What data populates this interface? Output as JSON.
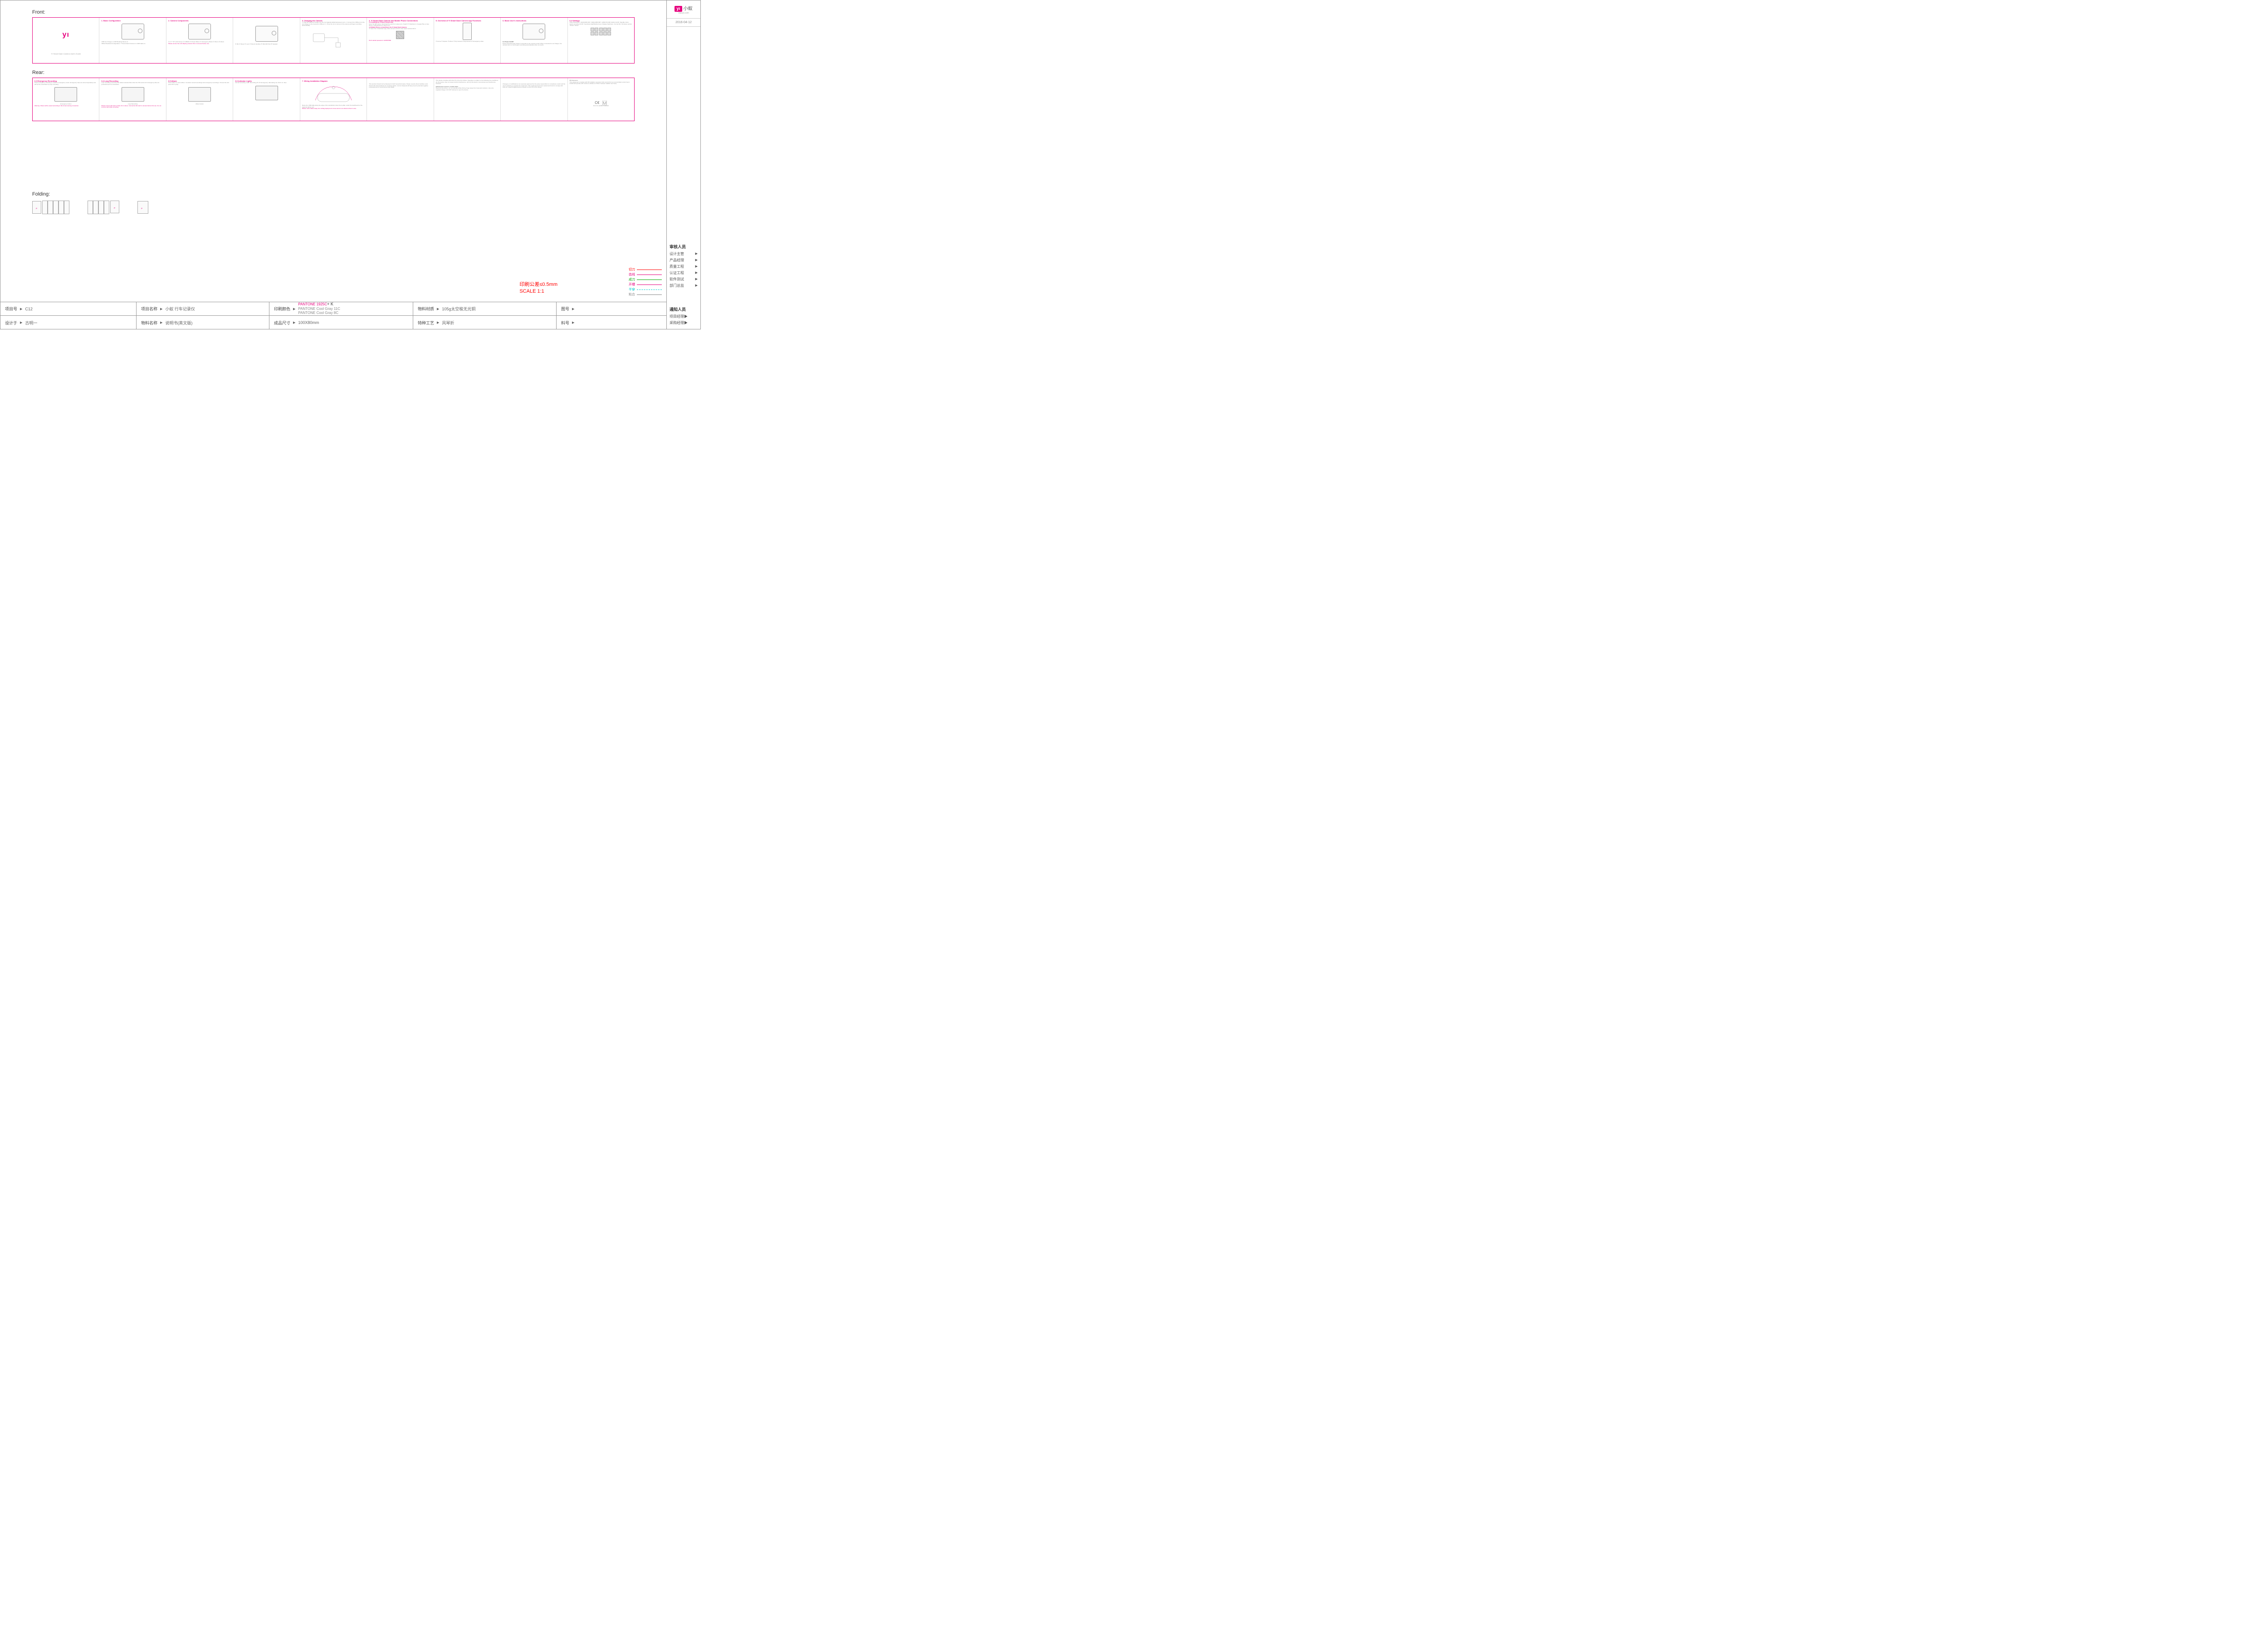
{
  "header": {
    "brand_text": "小蚁",
    "brand_sub": "xiaoyi.com",
    "date": "2016-04-12"
  },
  "labels": {
    "front": "Front:",
    "rear": "Rear:",
    "folding": "Folding:"
  },
  "front_panels": [
    {
      "title": "",
      "cap": "YI Smart Dash Camera User's Guide"
    },
    {
      "title": "1. Basic Configuration",
      "body": "USB Car Charger x1   360°Rotating Mount x1",
      "body2": "Official Standard Configuration: YI Smart Dash Camera x1  USB Cable x1"
    },
    {
      "title": "2. Camera Components",
      "body": "① 2.7\" TFT LCD Screen ② USB/AV ③ Power Button ④ Emergency Button ⑤ Menu ⑥ Album",
      "warn": "Please ensure the LCD display protector film is removed before use."
    },
    {
      "title": "",
      "body": "① Mic ② Reset ③ Lens ④ Mount interface ⑤ MicroSD Slot ⑥ Speaker"
    },
    {
      "title": "3. Charging the Camera",
      "body": "1. Plug the USB car charger into the car cigarette lighter/accessory port. 2. Connect the USB port on the car charger to the Camera's USB port. 3. Once the car is turned on the camera will begin recording automatically."
    },
    {
      "title": "4. YI Smart Dash Camera and Mobile Phone Connections",
      "sub": "4.1 Installing the YI Dash Camera App",
      "body": "Scan the QR code to download the app from xiaoyi.com. Search YI Dashcam in Google Play or App Store or download from xiaoyi.com.",
      "sub2": "4.2 Mobile Phone connecting to the YI Smart Dash Camera",
      "body2": "① Open the YI Dashcam app, click connect camera, then select camera Wi-Fi.",
      "warn": "Wi-Fi default password: 1234567890"
    },
    {
      "title": "5. Overview of YI Smart Dash Camera App Functions",
      "body": "① Home ② Square ③ Album ④ My Camera ⑤ My Account ⑥ Emergency video"
    },
    {
      "title": "6. Basic User's Instructions",
      "sub": "6.1 Power On/Off",
      "body": "Press and hold power button 3 seconds to turn camera on/off. When connected to car charger, the camera turns on and begins recording automatically when car starts."
    },
    {
      "title": "6.2 Settings",
      "body": "Video Resolution: 1920x1080 30P / 1920x1080 60P / 1280x720 30P. ADAS On/Off. Standby clock. Audio recording On/Off. Sensitivity High/Medium/Low. Display brightness. Format SD. Firmware version / Reset / About."
    }
  ],
  "rear_panels": [
    {
      "title": "6.3 Emergency Recording",
      "body": "Press emergency recording to switch to emergency mode. Emergency clips are stored separately and will not be overwritten by loop recording.",
      "cap": "Emergency button",
      "warn": "Warning: Videos will be saved according to file format naming convention."
    },
    {
      "title": "6.4 Loop Recording",
      "body": "Loop recording overwrites the oldest unlocked files when the SD card is full. Emergency files are protected and not overwritten.",
      "cap": "Loop Recording",
      "warn": "Please ensure SD card is Class 10 or above. Format the SD card in camera before first use. Do not remove card while recording."
    },
    {
      "title": "6.5 Album",
      "body": "Press Album to enter album. Contains normal recordings and emergency recordings. Choose file and press OK to play.",
      "cap": "Album button"
    },
    {
      "title": "6.6 Indicator Lights",
      "body": "Normal recording: solid. Recording off: off. Emergency: alternating red. Wi-Fi on: blue."
    },
    {
      "title": "7. Wiring Installation Diagram",
      "body": "Route the USB cable along the edge of the windshield, down the A-pillar, under the dashboard to the cigarette lighter port.",
      "warn": "Please route cables away from airbag deployment zones and do not obstruct driver's view."
    },
    {
      "title": "",
      "body": "This product should not be disposed of with household waste. Please recycle where facilities exist. Check with local authority for recycling advice. Correct disposal will help prevent potential negative consequences for environment and health."
    },
    {
      "title": "",
      "body": "This device complies with Part 15 of the FCC Rules. Operation is subject to the following two conditions: (1) this device may not cause harmful interference, and (2) this device must accept any interference received.",
      "sub": "IMPORTANT SAFETY GUIDELINES",
      "body2": "Read all instructions. Do not operate while driving. Keep away from heat and moisture. Use only supplied charger. DO NOT attempt to open the device."
    },
    {
      "title": "",
      "body": "Changes or modifications not expressly approved by the party responsible for compliance could void the user's authority to operate the equipment. This equipment has been tested and found to comply with limits for Class B digital device pursuant to Part 15 of FCC Rules."
    },
    {
      "title": "",
      "sub": "RF Exposure",
      "body": "This equipment complies with RF radiation exposure limits set forth for an uncontrolled environment. Install and operate with minimum distance of 20cm between radiator and body.",
      "ce": "FCC ID: 2AFIB-YCS1015"
    }
  ],
  "tolerance": {
    "l1": "印刷公差≤0.5mm",
    "l2": "SCALE 1:1"
  },
  "legend": [
    {
      "t": "切刀",
      "c": "red"
    },
    {
      "t": "齿线",
      "c": "mag"
    },
    {
      "t": "成刀",
      "c": "grn"
    },
    {
      "t": "开槽",
      "c": "mag"
    },
    {
      "t": "半穿",
      "c": "cyn"
    },
    {
      "t": "粘合",
      "c": "gry"
    }
  ],
  "bottom": {
    "r1": [
      {
        "k": "项目号",
        "v": "C12"
      },
      {
        "k": "项目名称",
        "v": "小蚁 行车记录仪"
      },
      {
        "k": "印刷颜色",
        "pantone": true
      },
      {
        "k": "物料材质",
        "v": "105g太空梭无光铜"
      },
      {
        "k": "图号",
        "v": ""
      }
    ],
    "r2": [
      {
        "k": "设计于",
        "v": "古明一"
      },
      {
        "k": "物料名称",
        "v": "说明书(英文版)"
      },
      {
        "k": "成品尺寸",
        "v": "100X80mm"
      },
      {
        "k": "特种工艺",
        "v": "风琴折"
      },
      {
        "k": "料号",
        "v": ""
      }
    ],
    "pantone": {
      "p1": "PANTONE 1925C",
      "pk": "+ K",
      "p2": "PANTONE Cool Gray 11C",
      "p3": "PANTONE Cool Gray 8C"
    }
  },
  "approval": {
    "title": "审核人员",
    "rows": [
      "设计主管",
      "产品经理",
      "质量工程",
      "认证工程",
      "软件测试",
      "部门总监"
    ]
  },
  "notify": {
    "title": "通知人员",
    "rows": [
      "项目经理",
      "采购经理"
    ]
  }
}
